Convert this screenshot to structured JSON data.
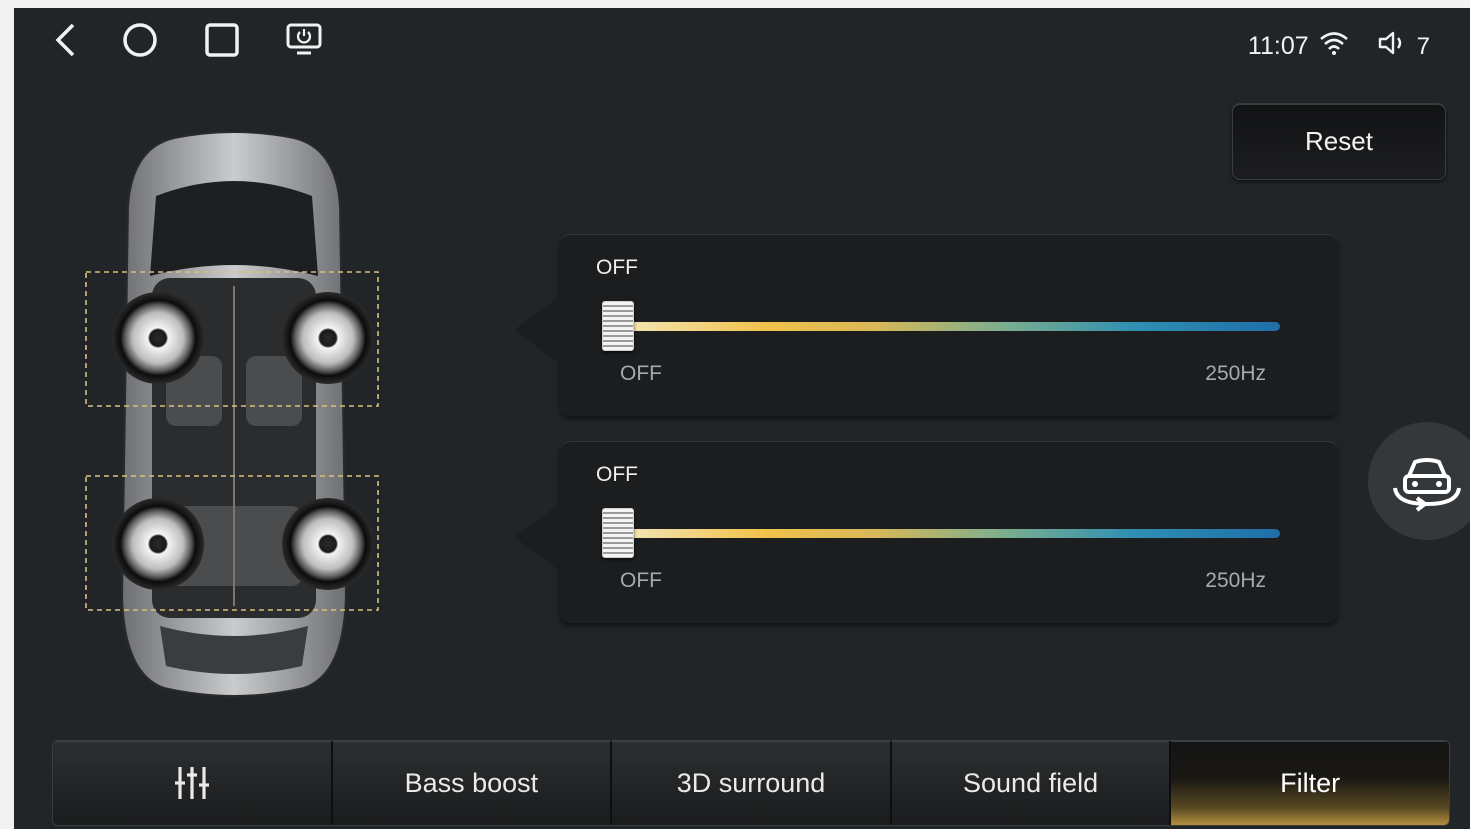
{
  "status_bar": {
    "time": "11:07",
    "volume": "7",
    "nav_icons": [
      "back-icon",
      "home-icon",
      "recents-icon",
      "screen-power-icon"
    ],
    "status_icons": [
      "wifi-icon",
      "volume-icon"
    ]
  },
  "reset_label": "Reset",
  "filters": [
    {
      "value_label": "OFF",
      "min_label": "OFF",
      "max_label": "250Hz",
      "position": 0
    },
    {
      "value_label": "OFF",
      "min_label": "OFF",
      "max_label": "250Hz",
      "position": 0
    }
  ],
  "tabs": [
    {
      "label": "",
      "icon": "equalizer-icon",
      "active": false
    },
    {
      "label": "Bass boost",
      "active": false
    },
    {
      "label": "3D surround",
      "active": false
    },
    {
      "label": "Sound field",
      "active": false
    },
    {
      "label": "Filter",
      "active": true
    }
  ],
  "colors": {
    "background": "#222527",
    "accent_gold": "#b28f3f",
    "slider_start": "#f0c24a",
    "slider_end": "#1f6ea8"
  }
}
